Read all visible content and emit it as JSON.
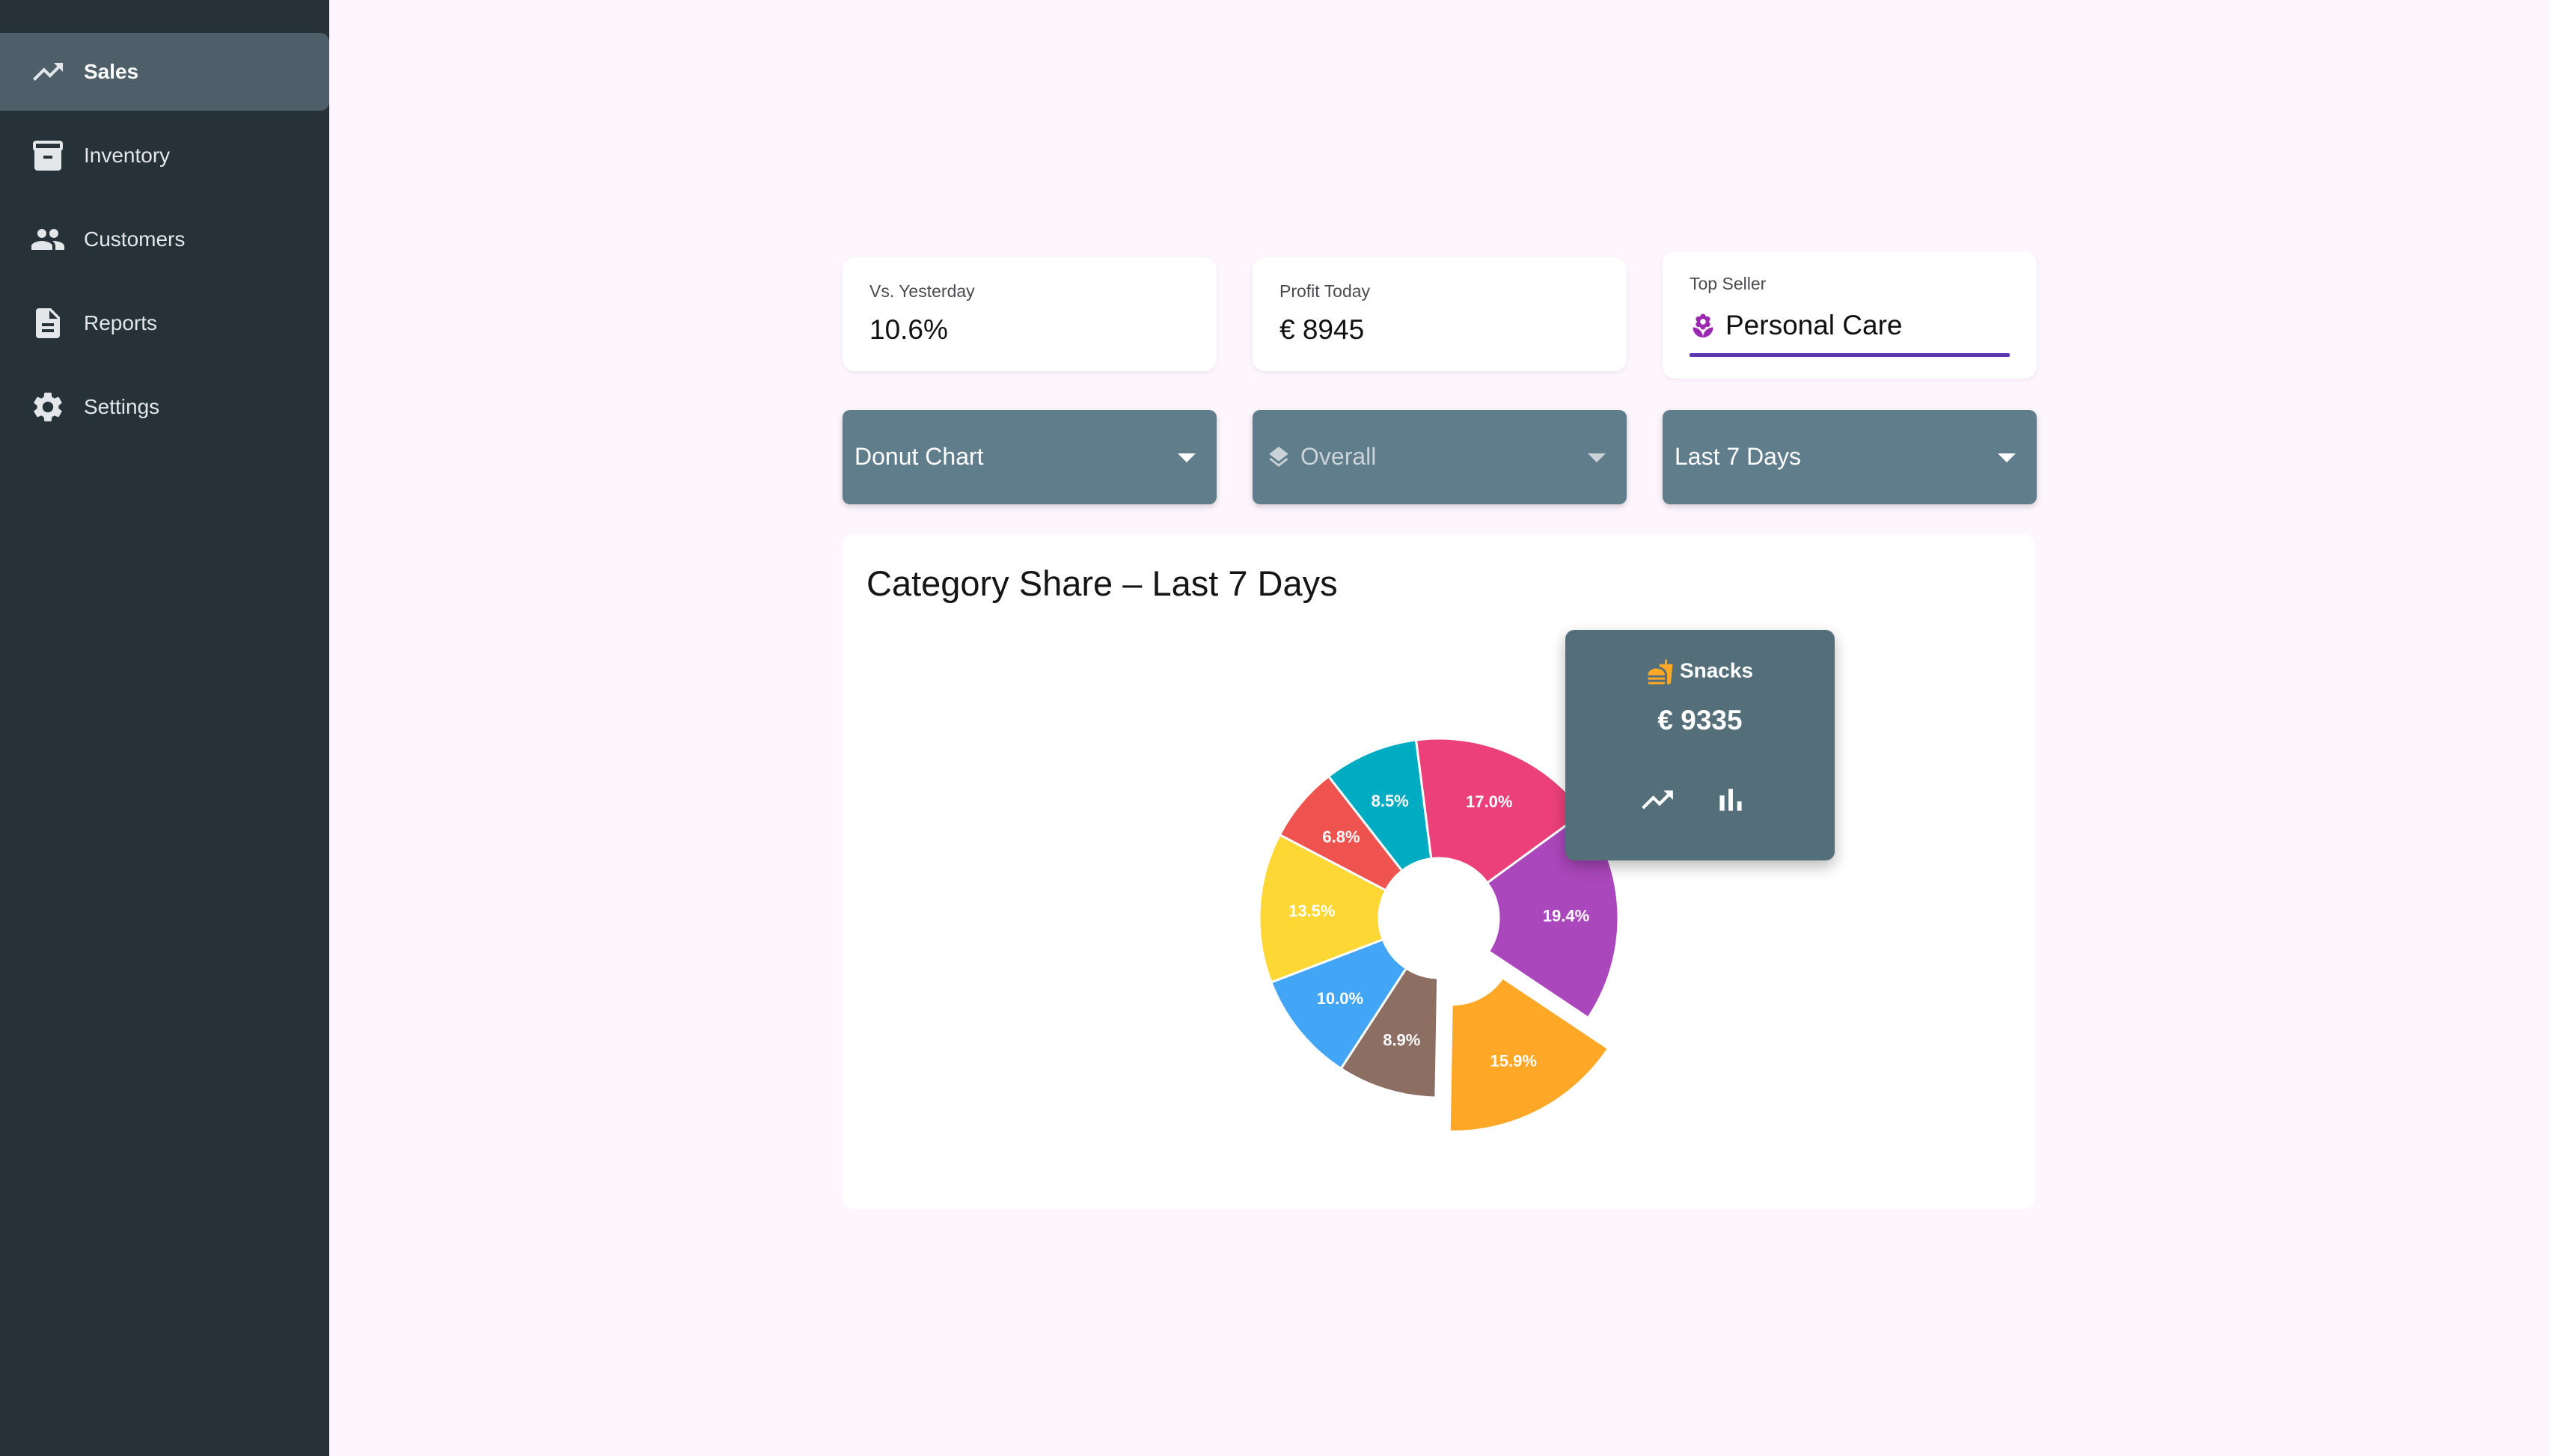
{
  "sidebar": {
    "items": [
      {
        "label": "Sales",
        "icon": "trending-up-icon",
        "active": true
      },
      {
        "label": "Inventory",
        "icon": "archive-box-icon",
        "active": false
      },
      {
        "label": "Customers",
        "icon": "people-icon",
        "active": false
      },
      {
        "label": "Reports",
        "icon": "document-icon",
        "active": false
      },
      {
        "label": "Settings",
        "icon": "gear-icon",
        "active": false
      }
    ]
  },
  "stats": {
    "vs_yesterday": {
      "label": "Vs. Yesterday",
      "value": "10.6%"
    },
    "profit_today": {
      "label": "Profit Today",
      "value": "€ 8945"
    },
    "top_seller": {
      "label": "Top Seller",
      "value": "Personal Care",
      "icon": "lotus-icon",
      "icon_color": "#9c27b0",
      "underline_color": "#5e35b1"
    }
  },
  "filters": {
    "chart_type": "Donut Chart",
    "scope": "Overall",
    "range": "Last 7 Days"
  },
  "chart_data": {
    "type": "pie",
    "title": "Category Share – Last 7 Days",
    "slices": [
      {
        "label": "19.4%",
        "value": 19.4,
        "color": "#ab47bc"
      },
      {
        "label": "15.9%",
        "value": 15.9,
        "color": "#ffa726",
        "exploded": true
      },
      {
        "label": "8.9%",
        "value": 8.9,
        "color": "#8d6e63"
      },
      {
        "label": "10.0%",
        "value": 10.0,
        "color": "#42a5f5"
      },
      {
        "label": "13.5%",
        "value": 13.5,
        "color": "#fdd835"
      },
      {
        "label": "6.8%",
        "value": 6.8,
        "color": "#ef5350"
      },
      {
        "label": "8.5%",
        "value": 8.5,
        "color": "#00acc1"
      },
      {
        "label": "17.0%",
        "value": 17.0,
        "color": "#ec407a"
      }
    ]
  },
  "tooltip": {
    "category": "Snacks",
    "icon": "snack-icon",
    "icon_color": "#ffa726",
    "value": "€ 9335",
    "actions": [
      "line-chart-icon",
      "bar-chart-icon"
    ]
  },
  "colors": {
    "sidebar_bg": "#263238",
    "active_item_bg": "#4e5f69",
    "dropdown_bg": "#607d8b",
    "page_bg": "#fdf6fd"
  }
}
